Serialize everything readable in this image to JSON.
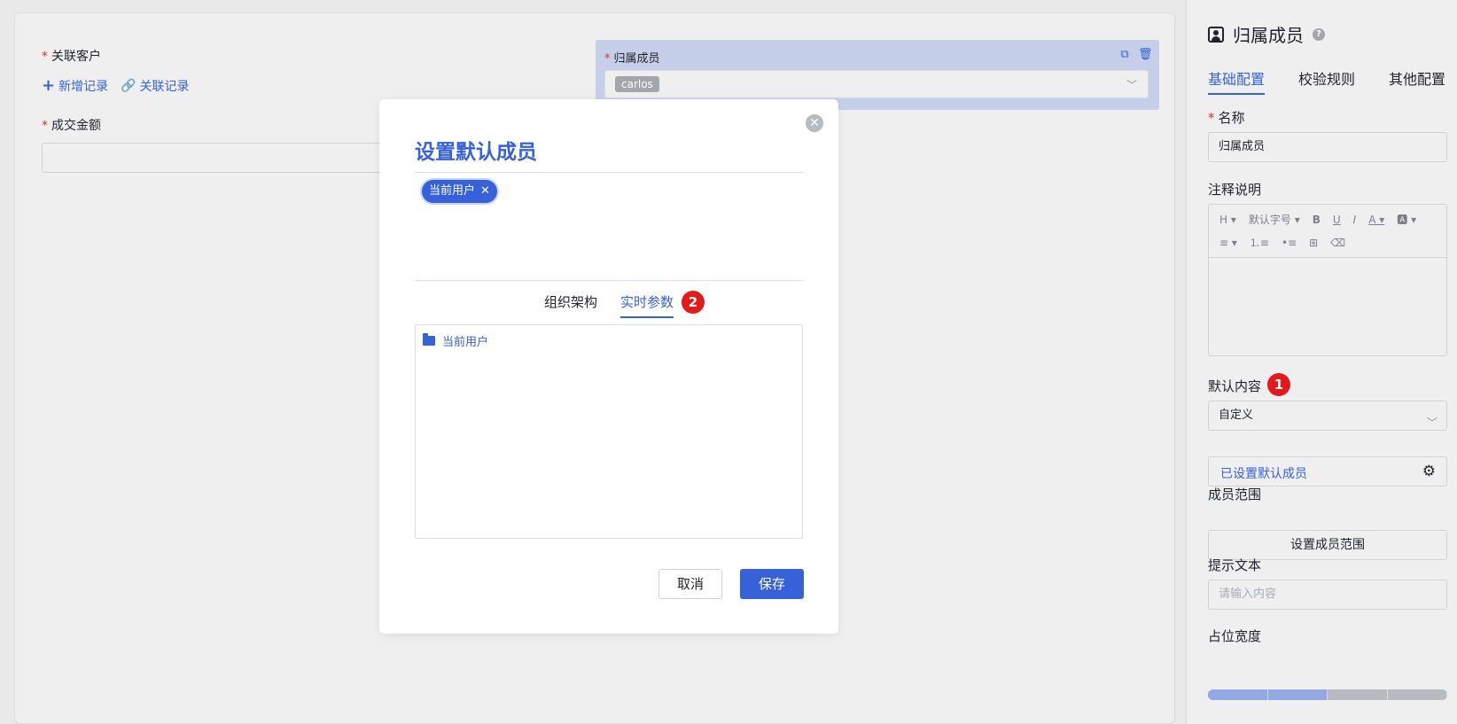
{
  "canvas": {
    "related_customer_label": "关联客户",
    "add_record": "新增记录",
    "link_record": "关联记录",
    "deal_amount_label": "成交金额",
    "member_label": "归属成员",
    "member_value": "carlos"
  },
  "modal": {
    "title": "设置默认成员",
    "selected_chip": "当前用户",
    "tabs": [
      {
        "label": "组织架构",
        "active": false
      },
      {
        "label": "实时参数",
        "active": true
      }
    ],
    "step_badge": "2",
    "tree_item": "当前用户",
    "cancel": "取消",
    "save": "保存"
  },
  "panel": {
    "title": "归属成员",
    "tabs": [
      {
        "label": "基础配置",
        "active": true
      },
      {
        "label": "校验规则",
        "active": false
      },
      {
        "label": "其他配置",
        "active": false
      }
    ],
    "name_label": "名称",
    "name_value": "归属成员",
    "note_label": "注释说明",
    "editor_toolbar": {
      "heading": "H ▾",
      "font_size": "默认字号 ▾",
      "bold": "B",
      "underline": "U",
      "italic": "I",
      "font_color": "A ▾",
      "bg_color": "🅰 ▾",
      "align": "≡ ▾",
      "ordered_list": "⒈≡",
      "unordered_list": "•≡",
      "image": "⊞",
      "clear": "⌫"
    },
    "default_label": "默认内容",
    "default_badge": "1",
    "default_value": "自定义",
    "default_set_text": "已设置默认成员",
    "range_label": "成员范围",
    "range_button": "设置成员范围",
    "hint_label": "提示文本",
    "hint_placeholder": "请输入内容",
    "width_label": "占位宽度",
    "width_segments": 4,
    "width_selected": 2
  },
  "colors": {
    "accent": "#3661d8",
    "required": "#e03131",
    "badge": "#e11b1b"
  }
}
